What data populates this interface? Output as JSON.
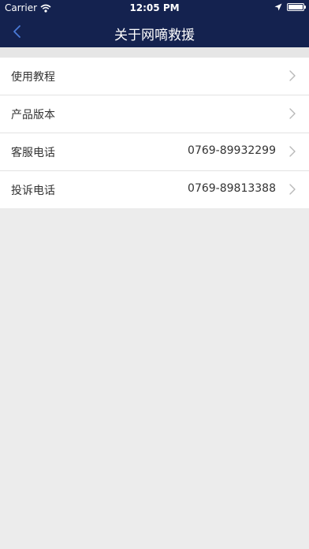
{
  "status_bar": {
    "carrier": "Carrier",
    "time": "12:05 PM",
    "battery_level": 1.0
  },
  "nav": {
    "title": "关于网嘀救援"
  },
  "menu": {
    "items": [
      {
        "label": "使用教程",
        "value": ""
      },
      {
        "label": "产品版本",
        "value": ""
      },
      {
        "label": "客服电话",
        "value": "0769-89932299"
      },
      {
        "label": "投诉电话",
        "value": "0769-89813388"
      }
    ]
  },
  "colors": {
    "nav_background": "#14224f",
    "page_background": "#ececec",
    "back_icon": "#4a7bd8"
  },
  "icons": {
    "back": "chevron-left-icon",
    "row_arrow": "chevron-right-icon",
    "wifi": "wifi-icon",
    "location": "location-arrow-icon",
    "battery": "battery-icon"
  }
}
